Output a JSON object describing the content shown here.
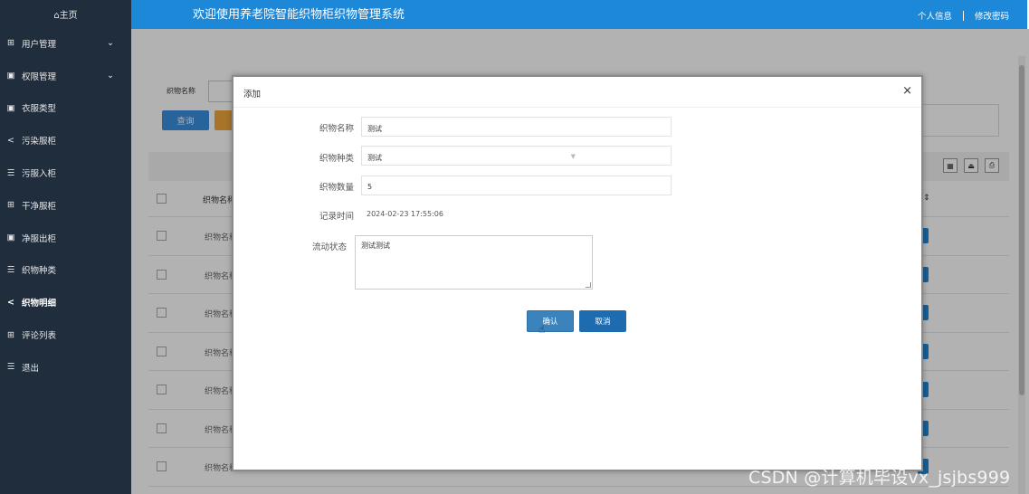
{
  "sidebar": {
    "home": "⌂主页",
    "items": [
      {
        "label": "用户管理",
        "icon": "grid-icon",
        "expandable": true
      },
      {
        "label": "权限管理",
        "icon": "book-icon",
        "expandable": true
      },
      {
        "label": "衣服类型",
        "icon": "book-icon",
        "expandable": false
      },
      {
        "label": "污染服柜",
        "icon": "share-icon",
        "expandable": false
      },
      {
        "label": "污服入柜",
        "icon": "list-icon",
        "expandable": false
      },
      {
        "label": "干净服柜",
        "icon": "grid-icon",
        "expandable": false
      },
      {
        "label": "净服出柜",
        "icon": "book-icon",
        "expandable": false
      },
      {
        "label": "织物种类",
        "icon": "list-icon",
        "expandable": false
      },
      {
        "label": "织物明细",
        "icon": "share-icon",
        "expandable": false,
        "active": true
      },
      {
        "label": "评论列表",
        "icon": "grid-icon",
        "expandable": false
      },
      {
        "label": "退出",
        "icon": "list-icon",
        "expandable": false
      }
    ]
  },
  "header": {
    "title": "欢迎使用养老院智能织物柜织物管理系统",
    "profile_link": "个人信息",
    "password_link": "修改密码"
  },
  "search": {
    "label": "织物名称",
    "query_button": "查询"
  },
  "table": {
    "header_col1": "织物名称",
    "sort_symbol": "⇕",
    "rows": [
      "织物名称",
      "织物名称",
      "织物名称",
      "织物名称",
      "织物名称",
      "织物名称",
      "织物名称"
    ]
  },
  "dialog": {
    "title": "添加",
    "close_icon": "×",
    "fields": {
      "name_label": "织物名称",
      "name_value": "测试",
      "type_label": "织物种类",
      "type_value": "测试",
      "qty_label": "织物数量",
      "qty_value": "5",
      "time_label": "记录时间",
      "time_value": "2024-02-23 17:55:06",
      "status_label": "流动状态",
      "status_value": "测试测试"
    },
    "confirm_button": "确认",
    "cancel_button": "取消"
  },
  "watermark": "CSDN @计算机毕设vx_jsjbs999",
  "colors": {
    "sidebar_bg": "#1f2d3d",
    "topbar_bg": "#1e88d8",
    "confirm_bg": "#3a83bd",
    "cancel_bg": "#1f6bb0"
  }
}
